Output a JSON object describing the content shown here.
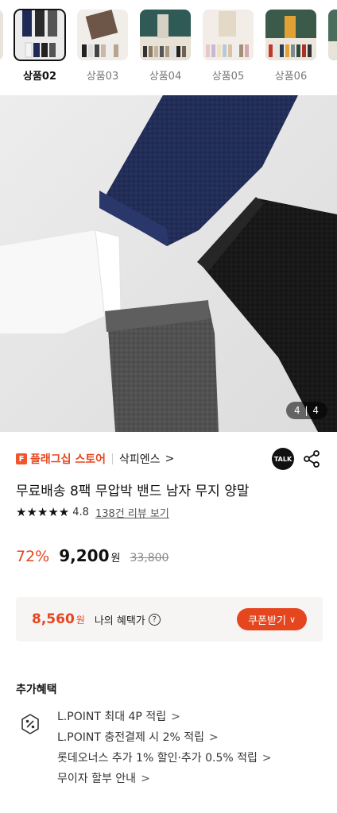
{
  "thumbnails": [
    {
      "label": "상품02",
      "selected": true
    },
    {
      "label": "상품03",
      "selected": false
    },
    {
      "label": "상품04",
      "selected": false
    },
    {
      "label": "상품05",
      "selected": false
    },
    {
      "label": "상품06",
      "selected": false
    }
  ],
  "hero": {
    "counter": "4 | 4"
  },
  "store": {
    "flag_badge": "F",
    "flag_text": "플래그십 스토어",
    "name": "삭피엔스",
    "chevron": ">",
    "talk_label": "TALK"
  },
  "product": {
    "title": "무료배송 8팩 무압박 밴드 남자 무지 양말",
    "stars": "★★★★★",
    "rating": "4.8",
    "review_link": "138건 리뷰 보기",
    "discount": "72%",
    "price": "9,200",
    "won": "원",
    "original_price": "33,800"
  },
  "benefit_box": {
    "price": "8,560",
    "won": "원",
    "label": "나의 혜택가",
    "help": "?",
    "coupon_button": "쿠폰받기",
    "coupon_chevron": "∨"
  },
  "extra_benefits": {
    "title": "추가혜택",
    "items": [
      "L.POINT 최대 4P 적립",
      "L.POINT 충전결제 시 2% 적립",
      "롯데오너스 추가 1% 할인·추가 0.5% 적립",
      "무이자 할부 안내"
    ],
    "chevron": ">"
  },
  "colors": {
    "accent": "#e6461e",
    "benefit_bg": "#f7f5f4"
  }
}
